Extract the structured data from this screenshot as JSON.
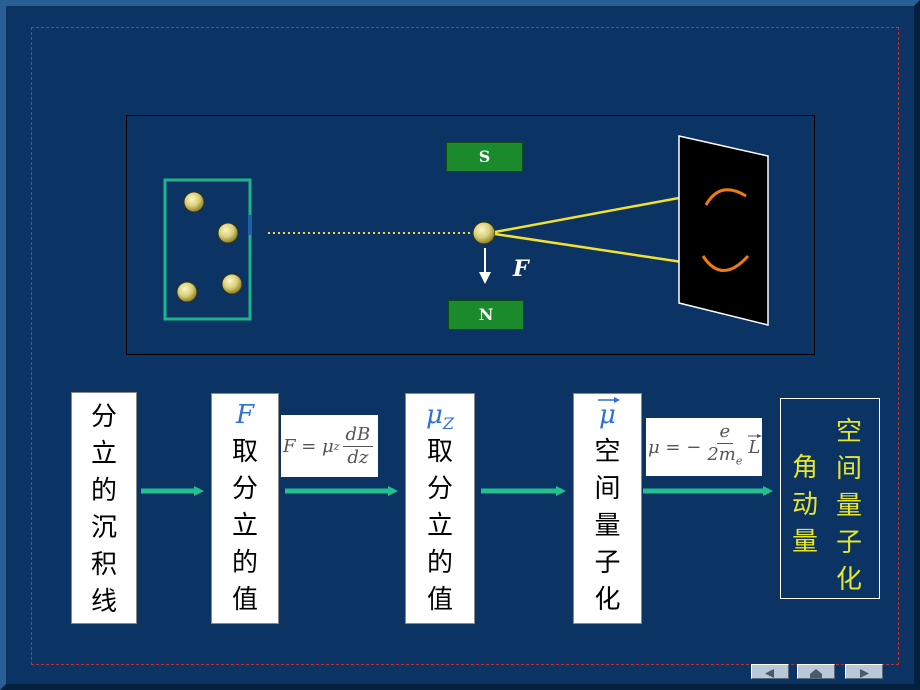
{
  "magnets": {
    "s_label": "S",
    "n_label": "N"
  },
  "force_label": "F",
  "flow": {
    "box1": [
      "分",
      "立",
      "的",
      "沉",
      "积",
      "线"
    ],
    "box2": {
      "symbol": "F",
      "chars": [
        "取",
        "分",
        "立",
        "的",
        "值"
      ]
    },
    "formula1": {
      "lhs": "F = μ",
      "sub": "z",
      "num": "dB",
      "den": "dz"
    },
    "box3": {
      "symbol": "μ",
      "symbol_sub": "Z",
      "chars": [
        "取",
        "分",
        "立",
        "的",
        "值"
      ]
    },
    "box4": {
      "symbol": "μ",
      "chars": [
        "空",
        "间",
        "量",
        "子",
        "化"
      ]
    },
    "formula2": {
      "lhs": "μ = −",
      "num": "e",
      "den": "2m",
      "den_sub": "e",
      "rhs": "L"
    },
    "box5": {
      "col_a": [
        "角",
        "动",
        "量"
      ],
      "col_b": [
        "空",
        "间",
        "量",
        "子",
        "化"
      ]
    }
  },
  "colors": {
    "background": "#0b3363",
    "magnet": "#1a8a2c",
    "beam": "#f2e12f",
    "arrow": "#22c08e",
    "pattern": "#f07a10",
    "highlight_text": "#e6e62a",
    "symbol": "#2f6fd6"
  },
  "nav": {
    "prev_icon": "left-triangle-icon",
    "home_icon": "home-icon",
    "next_icon": "right-triangle-icon"
  }
}
